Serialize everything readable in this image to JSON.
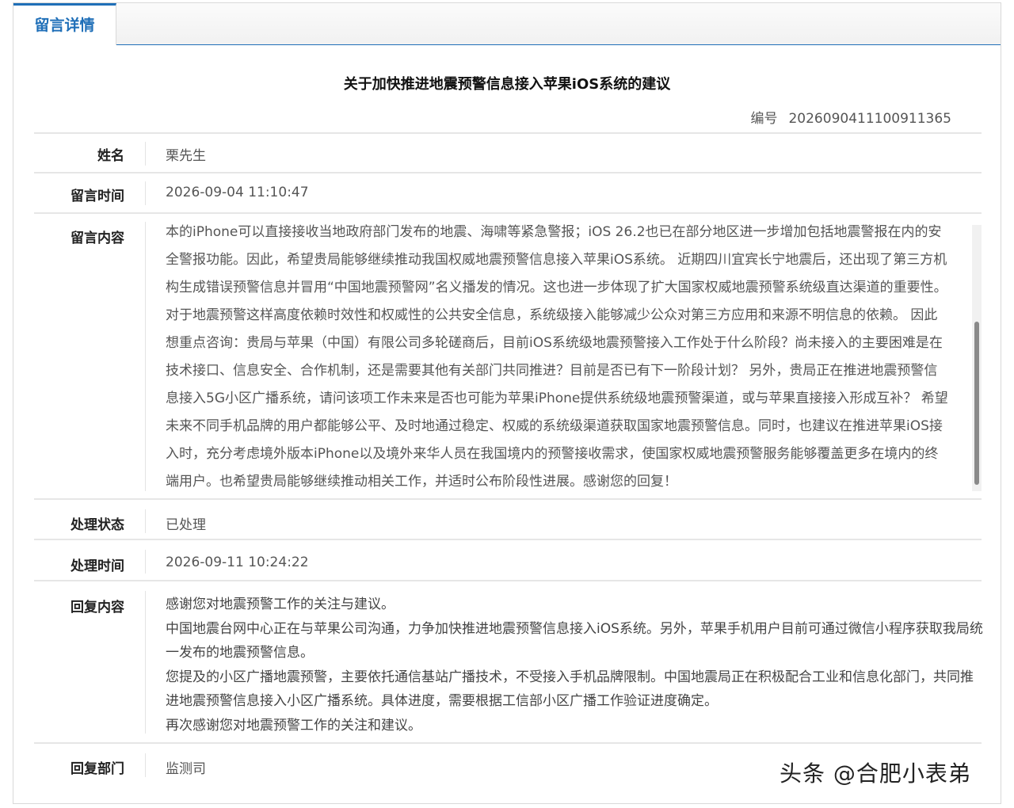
{
  "tab": {
    "label": "留言详情"
  },
  "message": {
    "title": "关于加快推进地震预警信息接入苹果iOS系统的建议",
    "serial_label": "编号",
    "serial_value": "2026090411100911365"
  },
  "fields": {
    "name": {
      "label": "姓名",
      "value": "栗先生"
    },
    "time": {
      "label": "留言时间",
      "value": "2026-09-04 11:10:47"
    },
    "content": {
      "label": "留言内容",
      "value": "本的iPhone可以直接接收当地政府部门发布的地震、海啸等紧急警报；iOS 26.2也已在部分地区进一步增加包括地震警报在内的安全警报功能。因此，希望贵局能够继续推动我国权威地震预警信息接入苹果iOS系统。 近期四川宜宾长宁地震后，还出现了第三方机构生成错误预警信息并冒用“中国地震预警网”名义播发的情况。这也进一步体现了扩大国家权威地震预警系统级直达渠道的重要性。对于地震预警这样高度依赖时效性和权威性的公共安全信息，系统级接入能够减少公众对第三方应用和来源不明信息的依赖。 因此想重点咨询：贵局与苹果（中国）有限公司多轮磋商后，目前iOS系统级地震预警接入工作处于什么阶段？尚未接入的主要困难是在技术接口、信息安全、合作机制，还是需要其他有关部门共同推进？目前是否已有下一阶段计划？ 另外，贵局正在推进地震预警信息接入5G小区广播系统，请问该项工作未来是否也可能为苹果iPhone提供系统级地震预警渠道，或与苹果直接接入形成互补？ 希望未来不同手机品牌的用户都能够公平、及时地通过稳定、权威的系统级渠道获取国家地震预警信息。同时，也建议在推进苹果iOS接入时，充分考虑境外版本iPhone以及境外来华人员在我国境内的预警接收需求，使国家权威地震预警服务能够覆盖更多在境内的终端用户。也希望贵局能够继续推动相关工作，并适时公布阶段性进展。感谢您的回复！"
    },
    "status": {
      "label": "处理状态",
      "value": "已处理"
    },
    "handled_time": {
      "label": "处理时间",
      "value": "2026-09-11 10:24:22"
    },
    "reply": {
      "label": "回复内容",
      "lines": [
        "感谢您对地震预警工作的关注与建议。",
        "中国地震台网中心正在与苹果公司沟通，力争加快推进地震预警信息接入iOS系统。另外，苹果手机用户目前可通过微信小程序获取我局统一发布的地震预警信息。",
        "您提及的小区广播地震预警，主要依托通信基站广播技术，不受接入手机品牌限制。中国地震局正在积极配合工业和信息化部门，共同推进地震预警信息接入小区广播系统。具体进度，需要根据工信部小区广播工作验证进度确定。",
        "再次感谢您对地震预警工作的关注和建议。"
      ]
    },
    "department": {
      "label": "回复部门",
      "value": "监测司"
    }
  },
  "watermark": {
    "text": "头条 @合肥小表弟"
  },
  "colors": {
    "accent": "#1f6fb8",
    "border": "#d9d9d9",
    "divider": "#e6e6e6"
  }
}
